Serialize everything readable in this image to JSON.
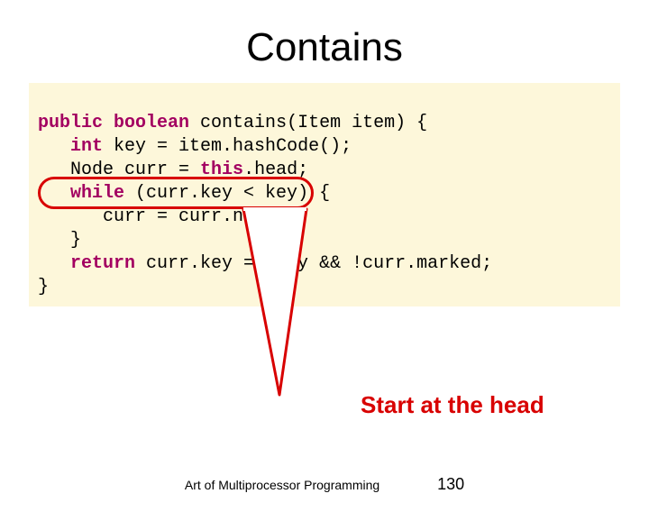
{
  "title": "Contains",
  "code": {
    "kw_public": "public",
    "kw_boolean": "boolean",
    "sig_rest": " contains(Item item) {",
    "kw_int": "int",
    "line2_rest": " key = item.hashCode();",
    "line3": "Node curr = ",
    "kw_this": "this",
    "line3_rest": ".head;",
    "kw_while": "while",
    "line4_rest": " (curr.key < key) {",
    "line5": "curr = curr.next;",
    "line6": "}",
    "kw_return": "return",
    "line7_rest": " curr.key == key && !curr.marked;",
    "line8": "}"
  },
  "annotation": "Start at the head",
  "footer_text": "Art of Multiprocessor Programming",
  "page_number": "130"
}
